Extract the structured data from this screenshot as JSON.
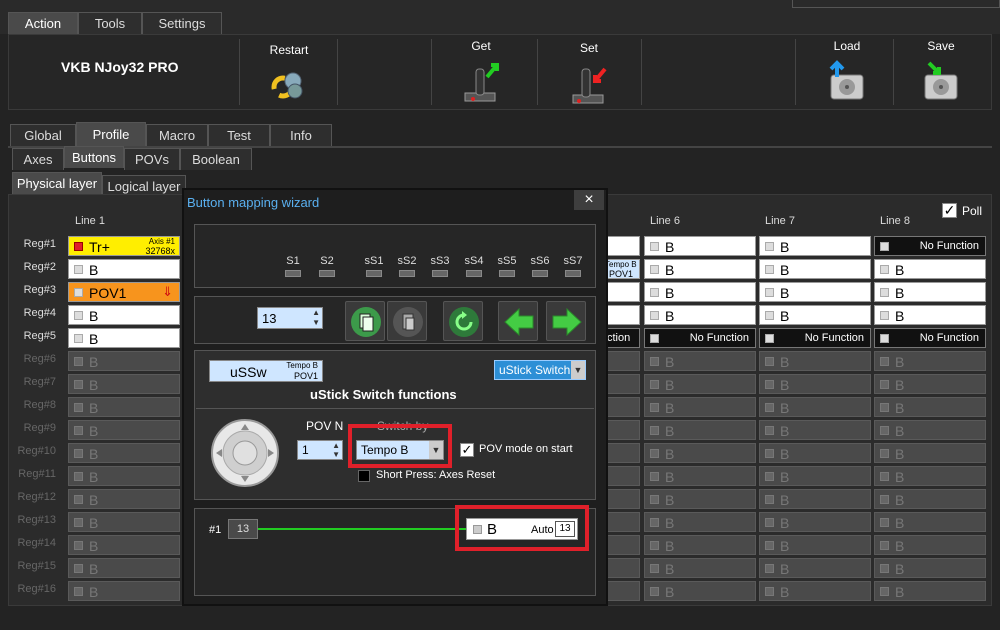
{
  "main_tabs": [
    "Action",
    "Tools",
    "Settings"
  ],
  "device": "VKB NJoy32 PRO",
  "toolbar": {
    "restart": "Restart",
    "get": "Get",
    "set": "Set",
    "load": "Load",
    "save": "Save"
  },
  "section_tabs": [
    "Global",
    "Profile",
    "Macro",
    "Test",
    "Info"
  ],
  "sub_tabs": [
    "Axes",
    "Buttons",
    "POVs",
    "Boolean"
  ],
  "layer_tabs": [
    "Physical layer",
    "Logical layer"
  ],
  "poll_label": "Poll",
  "line_headers": {
    "l1": "Line 1",
    "l6": "Line 6",
    "l7": "Line 7",
    "l8": "Line 8"
  },
  "regs": [
    "Reg#1",
    "Reg#2",
    "Reg#3",
    "Reg#4",
    "Reg#5",
    "Reg#6",
    "Reg#7",
    "Reg#8",
    "Reg#9",
    "Reg#10",
    "Reg#11",
    "Reg#12",
    "Reg#13",
    "Reg#14",
    "Reg#15",
    "Reg#16"
  ],
  "line1": {
    "r1_text": "Tr+",
    "r1_axis": "Axis #1",
    "r1_value": "32768x",
    "b": "B",
    "r3": "POV1"
  },
  "no_function": "No Function",
  "tempo_b": "Tempo B",
  "pov1": "POV1",
  "dialog": {
    "title": "Button mapping wizard",
    "close": "×",
    "slots": [
      "S1",
      "S2",
      "sS1",
      "sS2",
      "sS3",
      "sS4",
      "sS5",
      "sS6",
      "sS7"
    ],
    "number": "13",
    "uss_badge": "uSSw",
    "uss_tempo": "Tempo B",
    "uss_pov": "POV1",
    "function_select": "uStick Switch",
    "function_title": "uStick Switch functions",
    "pov_n_label": "POV N",
    "pov_n_value": "1",
    "switch_by_label": "Switch by",
    "switch_by_value": "Tempo B",
    "pov_mode_label": "POV mode on start",
    "short_press_label": "Short Press: Axes Reset",
    "chain_id": "#1",
    "chain_value": "13",
    "result_b": "B",
    "result_auto": "Auto",
    "result_num": "13"
  },
  "colors": {
    "highlight": "#e0202a",
    "yellow": "#ffee00",
    "orange": "#f7941d",
    "green": "#22cc22"
  }
}
